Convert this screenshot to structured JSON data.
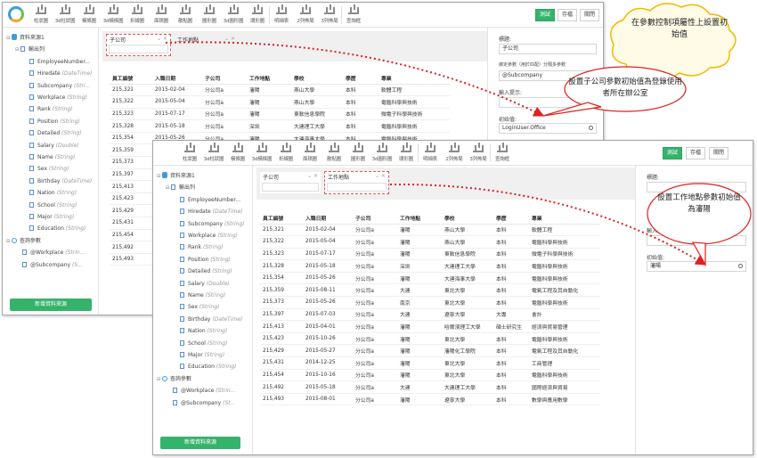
{
  "toolbar": {
    "tools": [
      "柱狀圖",
      "3d柱狀圖",
      "橫條圖",
      "3d橫條圖",
      "折線圖",
      "面積圖",
      "散點圖",
      "圓形圖",
      "3d圓形圖",
      "環形圖",
      "明細表",
      "2列佈局",
      "3列佈局",
      "查詢框"
    ],
    "buttons": {
      "test": "測試",
      "save": "存檔",
      "close": "關閉"
    }
  },
  "tree": {
    "source": "資料來源1",
    "output": "輸出列",
    "fields_win1": [
      {
        "name": "EmployeeNumber...",
        "type": ""
      },
      {
        "name": "Hiredate",
        "type": "(DateTime)"
      },
      {
        "name": "Subcompany",
        "type": "(Stri..."
      },
      {
        "name": "Workplace",
        "type": "(String)"
      },
      {
        "name": "Rank",
        "type": "(String)"
      },
      {
        "name": "Position",
        "type": "(String)"
      },
      {
        "name": "Detailed",
        "type": "(String)"
      },
      {
        "name": "Salary",
        "type": "(Double)"
      },
      {
        "name": "Name",
        "type": "(String)"
      },
      {
        "name": "Sex",
        "type": "(String)"
      },
      {
        "name": "Birthday",
        "type": "(DateTime)"
      },
      {
        "name": "Nation",
        "type": "(String)"
      },
      {
        "name": "School",
        "type": "(String)"
      },
      {
        "name": "Major",
        "type": "(String)"
      },
      {
        "name": "Education",
        "type": "(String)"
      }
    ],
    "fields_win2": [
      {
        "name": "EmployeeNumber...",
        "type": ""
      },
      {
        "name": "Hiredate",
        "type": "(DateTime)"
      },
      {
        "name": "Subcompany",
        "type": "(String)"
      },
      {
        "name": "Workplace",
        "type": "(String)"
      },
      {
        "name": "Rank",
        "type": "(String)"
      },
      {
        "name": "Position",
        "type": "(String)"
      },
      {
        "name": "Detailed",
        "type": "(String)"
      },
      {
        "name": "Salary",
        "type": "(Double)"
      },
      {
        "name": "Name",
        "type": "(String)"
      },
      {
        "name": "Sex",
        "type": "(String)"
      },
      {
        "name": "Birthday",
        "type": "(DateTime)"
      },
      {
        "name": "Nation",
        "type": "(String)"
      },
      {
        "name": "School",
        "type": "(String)"
      },
      {
        "name": "Major",
        "type": "(String)"
      },
      {
        "name": "Education",
        "type": "(String)"
      }
    ],
    "query": "查詢參數",
    "params_win1": [
      {
        "name": "@Workplace",
        "type": "(Strin..."
      },
      {
        "name": "@Subcompany",
        "type": "(S..."
      }
    ],
    "params_win2": [
      {
        "name": "@Workplace",
        "type": "(Strin..."
      },
      {
        "name": "@Subcompany",
        "type": "(St..."
      }
    ],
    "add_button": "新增資料來源"
  },
  "params": {
    "subcompany": "子公司",
    "workplace": "工作地點"
  },
  "table": {
    "headers": [
      "員工編號",
      "入職日期",
      "子公司",
      "工作地點",
      "學校",
      "學歷",
      "專業"
    ],
    "rows_win1": [
      [
        "215,321",
        "2015-02-04",
        "分公司a",
        "瀋陽",
        "燕山大學",
        "本科",
        "軟體工程"
      ],
      [
        "215,322",
        "2015-05-04",
        "分公司a",
        "瀋陽",
        "燕山大學",
        "本科",
        "電腦科學與技術"
      ],
      [
        "215,323",
        "2015-07-17",
        "分公司a",
        "瀋陽",
        "東軟信息學院",
        "本科",
        "微電子科學與技術"
      ],
      [
        "215,328",
        "2015-05-18",
        "分公司a",
        "深圳",
        "大連理工大學",
        "本科",
        "電腦科學與技術"
      ],
      [
        "215,354",
        "2015-05-26",
        "分公司a",
        "瀋陽",
        "大連海事大學",
        "本科",
        "電腦科學與技術"
      ],
      [
        "215,359",
        "",
        "",
        "",
        "",
        "",
        ""
      ],
      [
        "215,373",
        "",
        "",
        "",
        "",
        "",
        ""
      ],
      [
        "215,397",
        "",
        "",
        "",
        "",
        "",
        ""
      ],
      [
        "215,413",
        "",
        "",
        "",
        "",
        "",
        ""
      ],
      [
        "215,423",
        "",
        "",
        "",
        "",
        "",
        ""
      ],
      [
        "215,429",
        "",
        "",
        "",
        "",
        "",
        ""
      ],
      [
        "215,431",
        "",
        "",
        "",
        "",
        "",
        ""
      ],
      [
        "215,454",
        "",
        "",
        "",
        "",
        "",
        ""
      ],
      [
        "215,492",
        "",
        "",
        "",
        "",
        "",
        ""
      ],
      [
        "215,493",
        "",
        "",
        "",
        "",
        "",
        ""
      ]
    ],
    "rows_win2": [
      [
        "215,321",
        "2015-02-04",
        "分公司a",
        "瀋陽",
        "燕山大學",
        "本科",
        "軟體工程"
      ],
      [
        "215,322",
        "2015-05-04",
        "分公司a",
        "瀋陽",
        "燕山大學",
        "本科",
        "電腦科學與技術"
      ],
      [
        "215,323",
        "2015-07-17",
        "分公司a",
        "瀋陽",
        "東軟信息學院",
        "本科",
        "微電子科學與技術"
      ],
      [
        "215,328",
        "2015-05-18",
        "分公司a",
        "深圳",
        "大連理工大學",
        "本科",
        "電腦科學與技術"
      ],
      [
        "215,354",
        "2015-05-26",
        "分公司a",
        "瀋陽",
        "大連海事大學",
        "本科",
        "電腦科學與技術"
      ],
      [
        "215,359",
        "2015-08-11",
        "分公司a",
        "大連",
        "東北大學",
        "本科",
        "電氣工程及其自動化"
      ],
      [
        "215,373",
        "2015-05-26",
        "分公司a",
        "南京",
        "東北大學",
        "本科",
        "電腦科學與技術"
      ],
      [
        "215,397",
        "2015-07-03",
        "分公司a",
        "大連",
        "遼寧大學",
        "大專",
        "會計"
      ],
      [
        "215,413",
        "2015-04-01",
        "分公司a",
        "瀋陽",
        "哈爾濱理工大學",
        "碩士研究生",
        "經濟與貿易管理"
      ],
      [
        "215,423",
        "2015-10-26",
        "分公司a",
        "瀋陽",
        "東北大學",
        "本科",
        "電腦科學與技術"
      ],
      [
        "215,429",
        "2015-05-27",
        "分公司a",
        "瀋陽",
        "瀋陽化工學院",
        "本科",
        "電氣工程及其自動化"
      ],
      [
        "215,431",
        "2014-12-25",
        "分公司a",
        "瀋陽",
        "東北大學",
        "本科",
        "工商管理"
      ],
      [
        "215,454",
        "2015-10-16",
        "分公司a",
        "瀋陽",
        "東北大學",
        "本科",
        "電腦科學與技術"
      ],
      [
        "215,492",
        "2015-05-18",
        "分公司a",
        "大連",
        "大連理工大學",
        "本科",
        "國際經濟與貿易"
      ],
      [
        "215,493",
        "2015-08-01",
        "分公司a",
        "瀋陽",
        "遼寧大學",
        "本科",
        "數學與應用數學"
      ]
    ]
  },
  "props": {
    "title_label": "標題:",
    "title_value": "子公司",
    "bind_label": "綁定參數（用於匹配）分隔多參數",
    "bind_value": "@Subcompany",
    "hint_label": "輸入提示:",
    "init_label": "初始值:",
    "init_value_win1": "LoginUser.Office",
    "init_value_win2": "瀋陽"
  },
  "callouts": {
    "cloud": "在參數控制項屬性上設置初始值",
    "bubble1": "設置子公司參數初始值為登錄使用者所在辦公室",
    "bubble2": "設置工作地點參數初始值為瀋陽"
  },
  "colors": {
    "accent_green": "#35b36b",
    "accent_blue": "#3a9fd8",
    "arrow_red": "#e02020",
    "cloud_fill": "#fffbe6",
    "cloud_stroke": "#f0b800"
  }
}
